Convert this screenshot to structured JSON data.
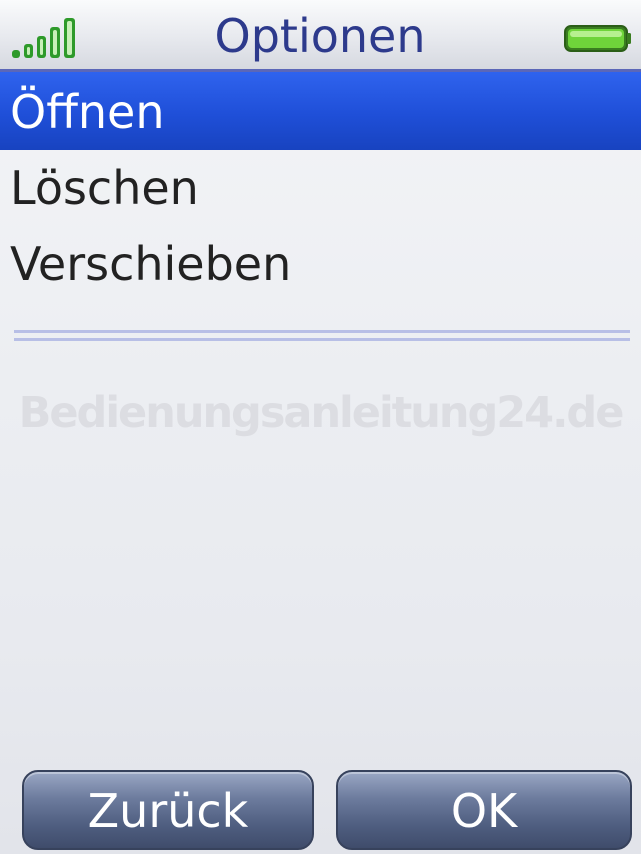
{
  "header": {
    "title": "Optionen",
    "signal_icon": "signal-bars-icon",
    "battery_icon": "battery-icon",
    "signal_color": "#2e9a2a",
    "battery_color": "#4fbf24"
  },
  "menu": {
    "items": [
      {
        "label": "Öffnen",
        "selected": true
      },
      {
        "label": "Löschen",
        "selected": false
      },
      {
        "label": "Verschieben",
        "selected": false
      }
    ],
    "highlight_color": "#1f4fd8"
  },
  "watermark": "Bedienungsanleitung24.de",
  "softkeys": {
    "left_label": "Zurück",
    "right_label": "OK"
  }
}
